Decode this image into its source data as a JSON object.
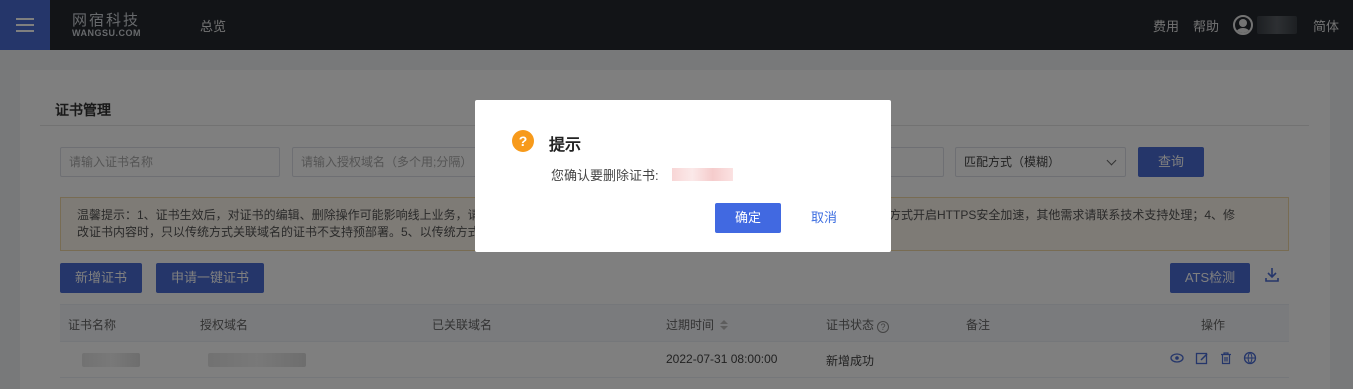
{
  "topbar": {
    "logo_cn": "网宿科技",
    "logo_en": "WANGSU.COM",
    "nav": "总览",
    "right": {
      "fees": "费用",
      "help": "帮助",
      "language": "简体"
    }
  },
  "page": {
    "title": "证书管理",
    "filters": {
      "cert_name_placeholder": "请输入证书名称",
      "domain_placeholder": "请输入授权域名（多个用;分隔）",
      "match_mode": "匹配方式（模糊）",
      "query_label": "查询"
    },
    "tip_line1_left": "温馨提示：1、证书生效后，对证书的编辑、删除操作可能影响线上业务，请",
    "tip_line1_right": "方式开启HTTPS安全加速，其他需求请联系技术支持处理；4、修",
    "tip_line2_left": "改证书内容时，只以传统方式关联域名的证书不支持预部署。5、以传统方式",
    "actions": {
      "add_cert": "新增证书",
      "one_click_cert": "申请一键证书",
      "ats_check": "ATS检测"
    },
    "table": {
      "columns": [
        "证书名称",
        "授权域名",
        "已关联域名",
        "过期时间",
        "证书状态",
        "备注",
        "操作"
      ],
      "rows": [
        {
          "expire": "2022-07-31 08:00:00",
          "status": "新增成功"
        }
      ]
    }
  },
  "dialog": {
    "icon": "?",
    "title": "提示",
    "message": "您确认要删除证书:",
    "confirm_label": "确定",
    "cancel_label": "取消"
  }
}
